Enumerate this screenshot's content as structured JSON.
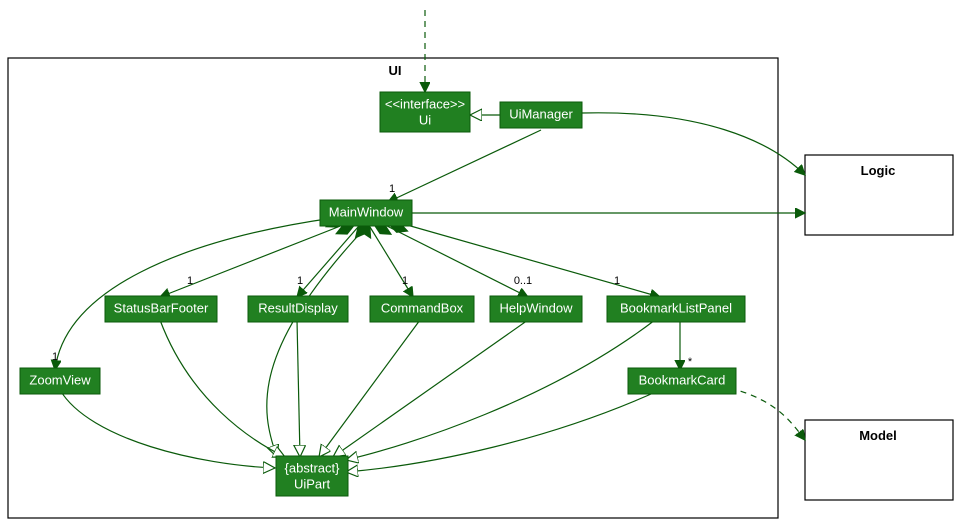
{
  "package_name": "UI",
  "external_packages": {
    "logic": "Logic",
    "model": "Model"
  },
  "classes": {
    "ui_interface": {
      "stereotype": "<<interface>>",
      "name": "Ui"
    },
    "ui_manager": "UiManager",
    "main_window": "MainWindow",
    "status_bar_footer": "StatusBarFooter",
    "result_display": "ResultDisplay",
    "command_box": "CommandBox",
    "help_window": "HelpWindow",
    "bookmark_list_panel": "BookmarkListPanel",
    "zoom_view": "ZoomView",
    "bookmark_card": "BookmarkCard",
    "ui_part": {
      "stereotype": "{abstract}",
      "name": "UiPart"
    }
  },
  "multiplicities": {
    "mw_to_manager": "1",
    "mw_zoom": "1",
    "mw_status": "1",
    "mw_result": "1",
    "mw_cmd": "1",
    "mw_help": "0..1",
    "mw_blp": "1",
    "blp_card": "*"
  },
  "chart_data": {
    "type": "table",
    "description": "UML class diagram for UI package",
    "nodes": [
      {
        "id": "Ui",
        "stereotype": "interface",
        "package": "UI"
      },
      {
        "id": "UiManager",
        "package": "UI"
      },
      {
        "id": "MainWindow",
        "package": "UI"
      },
      {
        "id": "StatusBarFooter",
        "package": "UI"
      },
      {
        "id": "ResultDisplay",
        "package": "UI"
      },
      {
        "id": "CommandBox",
        "package": "UI"
      },
      {
        "id": "HelpWindow",
        "package": "UI"
      },
      {
        "id": "BookmarkListPanel",
        "package": "UI"
      },
      {
        "id": "ZoomView",
        "package": "UI"
      },
      {
        "id": "BookmarkCard",
        "package": "UI"
      },
      {
        "id": "UiPart",
        "stereotype": "abstract",
        "package": "UI"
      },
      {
        "id": "Logic",
        "package": "external"
      },
      {
        "id": "Model",
        "package": "external"
      }
    ],
    "edges": [
      {
        "from": "external-top",
        "to": "Ui",
        "type": "dependency"
      },
      {
        "from": "UiManager",
        "to": "Ui",
        "type": "realization"
      },
      {
        "from": "UiManager",
        "to": "MainWindow",
        "type": "association",
        "multiplicity_target": "1"
      },
      {
        "from": "MainWindow",
        "to": "ZoomView",
        "type": "composition",
        "multiplicity_target": "1"
      },
      {
        "from": "MainWindow",
        "to": "StatusBarFooter",
        "type": "composition",
        "multiplicity_target": "1"
      },
      {
        "from": "MainWindow",
        "to": "ResultDisplay",
        "type": "composition",
        "multiplicity_target": "1"
      },
      {
        "from": "MainWindow",
        "to": "CommandBox",
        "type": "composition",
        "multiplicity_target": "1"
      },
      {
        "from": "MainWindow",
        "to": "HelpWindow",
        "type": "composition",
        "multiplicity_target": "0..1"
      },
      {
        "from": "MainWindow",
        "to": "BookmarkListPanel",
        "type": "composition",
        "multiplicity_target": "1"
      },
      {
        "from": "BookmarkListPanel",
        "to": "BookmarkCard",
        "type": "association",
        "multiplicity_target": "*"
      },
      {
        "from": "MainWindow",
        "to": "UiPart",
        "type": "generalization"
      },
      {
        "from": "ZoomView",
        "to": "UiPart",
        "type": "generalization"
      },
      {
        "from": "StatusBarFooter",
        "to": "UiPart",
        "type": "generalization"
      },
      {
        "from": "ResultDisplay",
        "to": "UiPart",
        "type": "generalization"
      },
      {
        "from": "CommandBox",
        "to": "UiPart",
        "type": "generalization"
      },
      {
        "from": "HelpWindow",
        "to": "UiPart",
        "type": "generalization"
      },
      {
        "from": "BookmarkListPanel",
        "to": "UiPart",
        "type": "generalization"
      },
      {
        "from": "BookmarkCard",
        "to": "UiPart",
        "type": "generalization"
      },
      {
        "from": "UiManager",
        "to": "Logic",
        "type": "association"
      },
      {
        "from": "MainWindow",
        "to": "Logic",
        "type": "association"
      },
      {
        "from": "BookmarkCard",
        "to": "Model",
        "type": "dependency"
      }
    ]
  }
}
